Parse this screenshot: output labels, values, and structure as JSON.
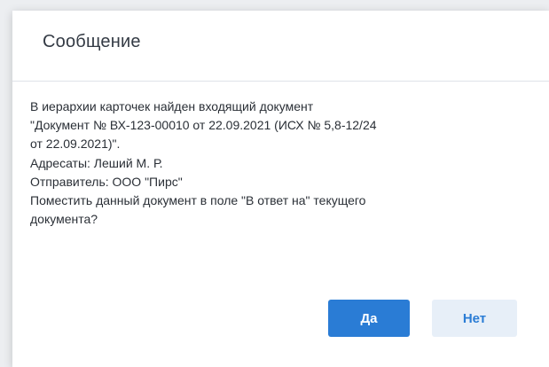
{
  "dialog": {
    "title": "Сообщение",
    "message": {
      "line1": "В иерархии карточек найден входящий документ",
      "line2": "\"Документ № ВХ-123-00010 от 22.09.2021 (ИСХ № 5,8-12/24",
      "line3": "от 22.09.2021)\".",
      "addressees": "Адресаты: Леший М. Р.",
      "sender": "Отправитель: ООО \"Пирс\"",
      "question_line1": "Поместить данный документ в поле \"В ответ на\" текущего",
      "question_line2": "документа?"
    },
    "buttons": {
      "yes_label": "Да",
      "no_label": "Нет"
    }
  },
  "colors": {
    "primary": "#2a7cd5",
    "secondary_bg": "#e7eff8",
    "title_text": "#333a44",
    "body_text": "#2a2f36"
  }
}
